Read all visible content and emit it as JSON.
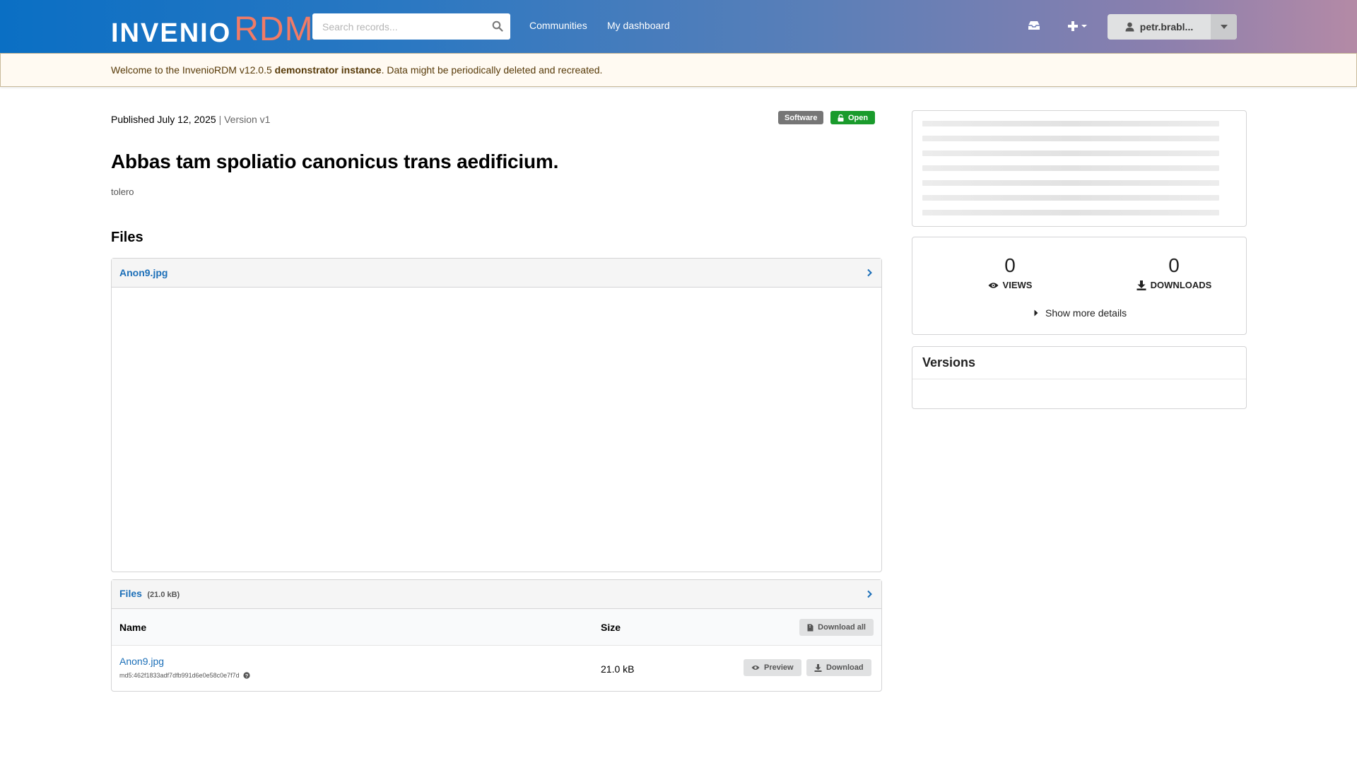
{
  "header": {
    "logo_main": "INVENIO",
    "logo_accent": "RDM",
    "search_placeholder": "Search records...",
    "nav": [
      "Communities",
      "My dashboard"
    ],
    "user_label": "petr.brabl..."
  },
  "banner": {
    "prefix": "Welcome to the InvenioRDM v12.0.5 ",
    "bold": "demonstrator instance",
    "suffix": ". Data might be periodically deleted and recreated."
  },
  "record": {
    "published": "Published July 12, 2025",
    "separator": "|",
    "version": "Version v1",
    "resource_type": "Software",
    "access": "Open",
    "title": "Abbas tam spoliatio canonicus trans aedificium.",
    "creator": "tolero"
  },
  "files": {
    "heading": "Files",
    "preview_filename": "Anon9.jpg",
    "list_title": "Files",
    "list_total_size": "(21.0 kB)",
    "col_name": "Name",
    "col_size": "Size",
    "download_all_label": "Download all",
    "rows": [
      {
        "name": "Anon9.jpg",
        "checksum": "md5:462f1833adf7dfb991d6e0e58c0e7f7d",
        "size": "21.0 kB",
        "preview_label": "Preview",
        "download_label": "Download"
      }
    ]
  },
  "stats": {
    "views_count": "0",
    "views_label": "VIEWS",
    "downloads_count": "0",
    "downloads_label": "DOWNLOADS",
    "more_details": "Show more details"
  },
  "versions": {
    "heading": "Versions"
  },
  "colors": {
    "link": "#1c6fb8",
    "open_badge": "#1a9b2c",
    "software_badge": "#767676",
    "logo_accent": "#f27b66"
  }
}
